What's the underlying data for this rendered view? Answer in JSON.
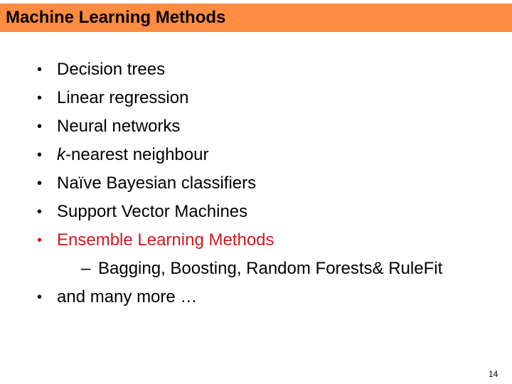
{
  "slide": {
    "title": "Machine Learning Methods",
    "colors": {
      "title_bar": "#ff8c40",
      "highlight": "#d01820",
      "text": "#000000"
    },
    "bullet_marker": "•",
    "sub_marker": "–",
    "items": [
      {
        "text": "Decision trees"
      },
      {
        "text": "Linear regression"
      },
      {
        "text": "Neural networks"
      },
      {
        "italic_prefix": "k",
        "text": "-nearest neighbour"
      },
      {
        "text": "Naïve Bayesian classifiers"
      },
      {
        "text": "Support Vector Machines"
      },
      {
        "text": "Ensemble Learning Methods",
        "highlighted": true
      },
      {
        "text": "Bagging, Boosting, Random Forests& RuleFit",
        "level": 2
      },
      {
        "text": "and many more …"
      }
    ],
    "page_number": "14"
  }
}
